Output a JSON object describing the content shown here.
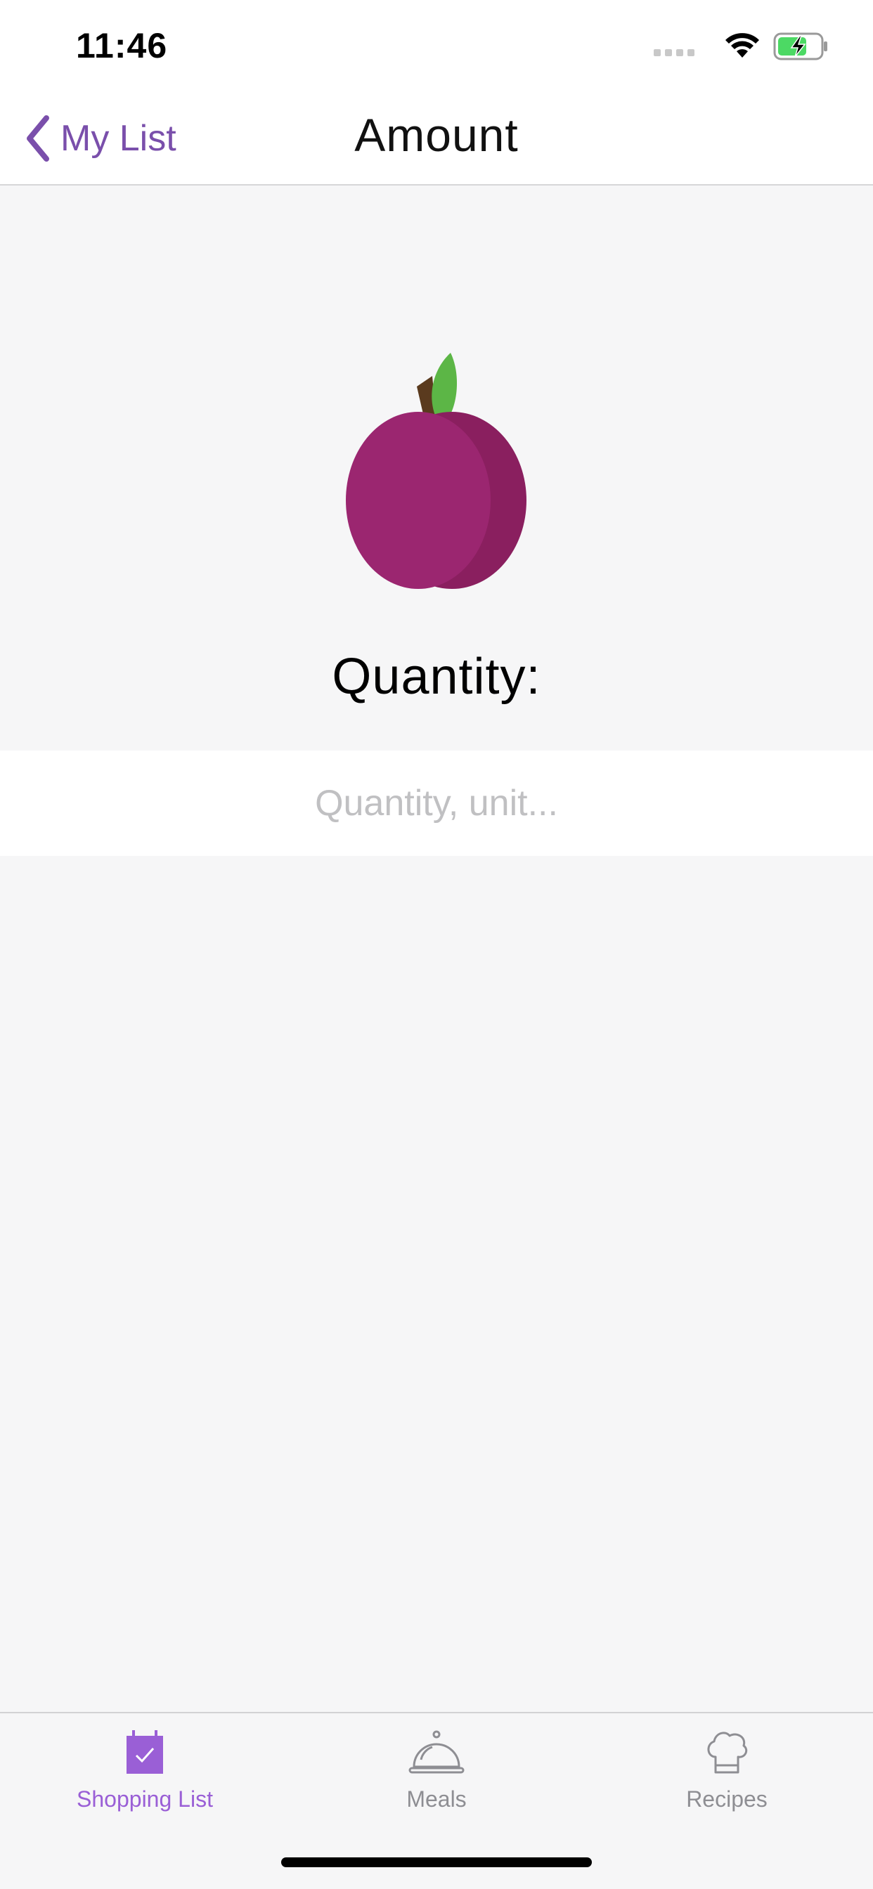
{
  "status_bar": {
    "time": "11:46",
    "icons": [
      "signal-icon",
      "wifi-icon",
      "battery-charging-icon"
    ],
    "battery_color": "#4cd964"
  },
  "nav": {
    "back_label": "My List",
    "title": "Amount"
  },
  "item": {
    "icon": "plum-icon",
    "quantity_heading": "Quantity:",
    "quantity_placeholder": "Quantity, unit...",
    "quantity_value": ""
  },
  "tabs": [
    {
      "label": "Shopping List",
      "icon": "shopping-list-icon",
      "active": true
    },
    {
      "label": "Meals",
      "icon": "cloche-icon",
      "active": false
    },
    {
      "label": "Recipes",
      "icon": "chef-hat-icon",
      "active": false
    }
  ],
  "colors": {
    "accent": "#7a4fab",
    "tab_active": "#9a5fd6",
    "plum": "#9b2670",
    "leaf": "#5cb646"
  }
}
